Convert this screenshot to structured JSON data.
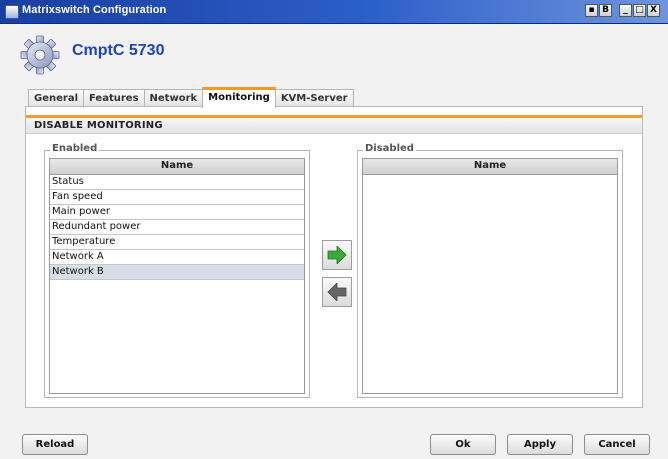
{
  "window": {
    "title": "Matrixswitch Configuration",
    "controls": [
      "▪",
      "B",
      "_",
      "□",
      "X"
    ]
  },
  "header": {
    "device_title": "CmptC 5730",
    "icon": "gear-icon"
  },
  "tabs": [
    {
      "label": "General",
      "active": false
    },
    {
      "label": "Features",
      "active": false
    },
    {
      "label": "Network",
      "active": false
    },
    {
      "label": "Monitoring",
      "active": true
    },
    {
      "label": "KVM-Server",
      "active": false
    }
  ],
  "section": {
    "title": "DISABLE MONITORING"
  },
  "enabled": {
    "group_title": "Enabled",
    "column": "Name",
    "items": [
      "Status",
      "Fan speed",
      "Main power",
      "Redundant power",
      "Temperature",
      "Network A",
      "Network B"
    ],
    "selected": "Network B"
  },
  "disabled": {
    "group_title": "Disabled",
    "column": "Name",
    "items": []
  },
  "arrows": {
    "move_right_icon": "arrow-right-icon",
    "move_left_icon": "arrow-left-icon",
    "right_color": "#3aa83a",
    "left_color": "#666666"
  },
  "buttons": {
    "reload": "Reload",
    "ok": "Ok",
    "apply": "Apply",
    "cancel": "Cancel"
  },
  "colors": {
    "accent": "#f29a2e",
    "title_blue": "#1f45b5"
  }
}
